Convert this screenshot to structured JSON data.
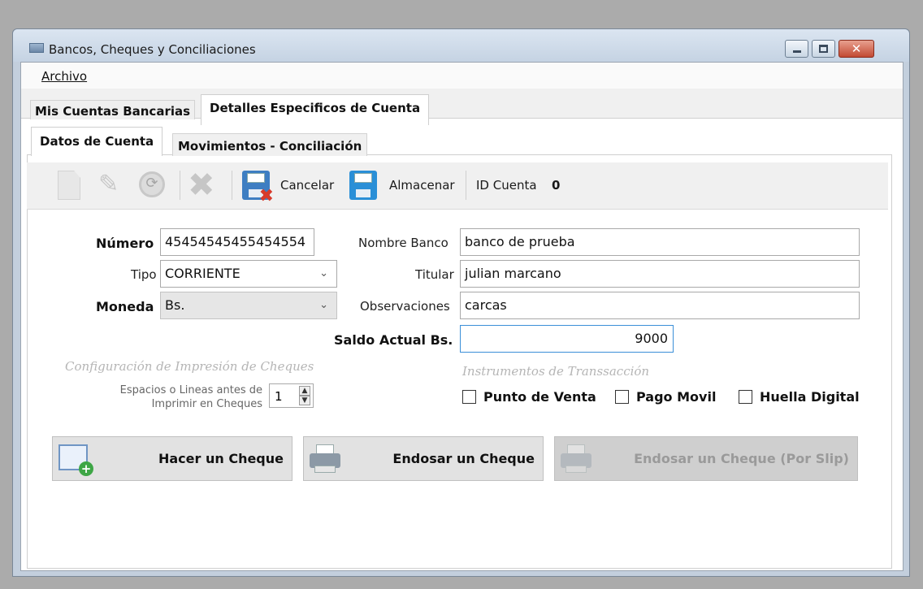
{
  "window": {
    "title": "Bancos, Cheques y Conciliaciones"
  },
  "menu": {
    "archivo": "Archivo"
  },
  "tabs_main": [
    "Mis Cuentas Bancarias",
    "Detalles Especificos de Cuenta"
  ],
  "tabs_sub": [
    "Datos de Cuenta",
    "Movimientos - Conciliación"
  ],
  "toolbar": {
    "icons": [
      "new-document-icon",
      "edit-icon",
      "refresh-icon",
      "delete-icon",
      "cancel-floppy-icon",
      "save-floppy-icon"
    ],
    "cancel_label": "Cancelar",
    "save_label": "Almacenar",
    "id_label": "ID Cuenta",
    "id_value": "0"
  },
  "form": {
    "numero_label": "Número",
    "numero_value": "45454545455454554",
    "tipo_label": "Tipo",
    "tipo_value": "CORRIENTE",
    "moneda_label": "Moneda",
    "moneda_value": "Bs.",
    "nombre_banco_label": "Nombre Banco",
    "nombre_banco_value": "banco de prueba",
    "titular_label": "Titular",
    "titular_value": "julian marcano",
    "observaciones_label": "Observaciones",
    "observaciones_value": "carcas",
    "saldo_label": "Saldo Actual Bs.",
    "saldo_value": "9000"
  },
  "print_config": {
    "title": "Configuración de Impresión de Cheques",
    "lines_label_1": "Espacios o Lineas antes de",
    "lines_label_2": "Imprimir en Cheques",
    "lines_value": "1"
  },
  "instruments": {
    "title": "Instrumentos de Transsacción",
    "punto_venta": "Punto de Venta",
    "pago_movil": "Pago Movil",
    "huella_digital": "Huella Digital"
  },
  "actions": {
    "hacer_cheque": "Hacer un Cheque",
    "endosar_cheque": "Endosar un Cheque",
    "endosar_slip": "Endosar un Cheque (Por Slip)"
  },
  "colors": {
    "accent": "#3b8fd8",
    "title_bar": "#c5d3e3",
    "close_button": "#c24a33"
  }
}
